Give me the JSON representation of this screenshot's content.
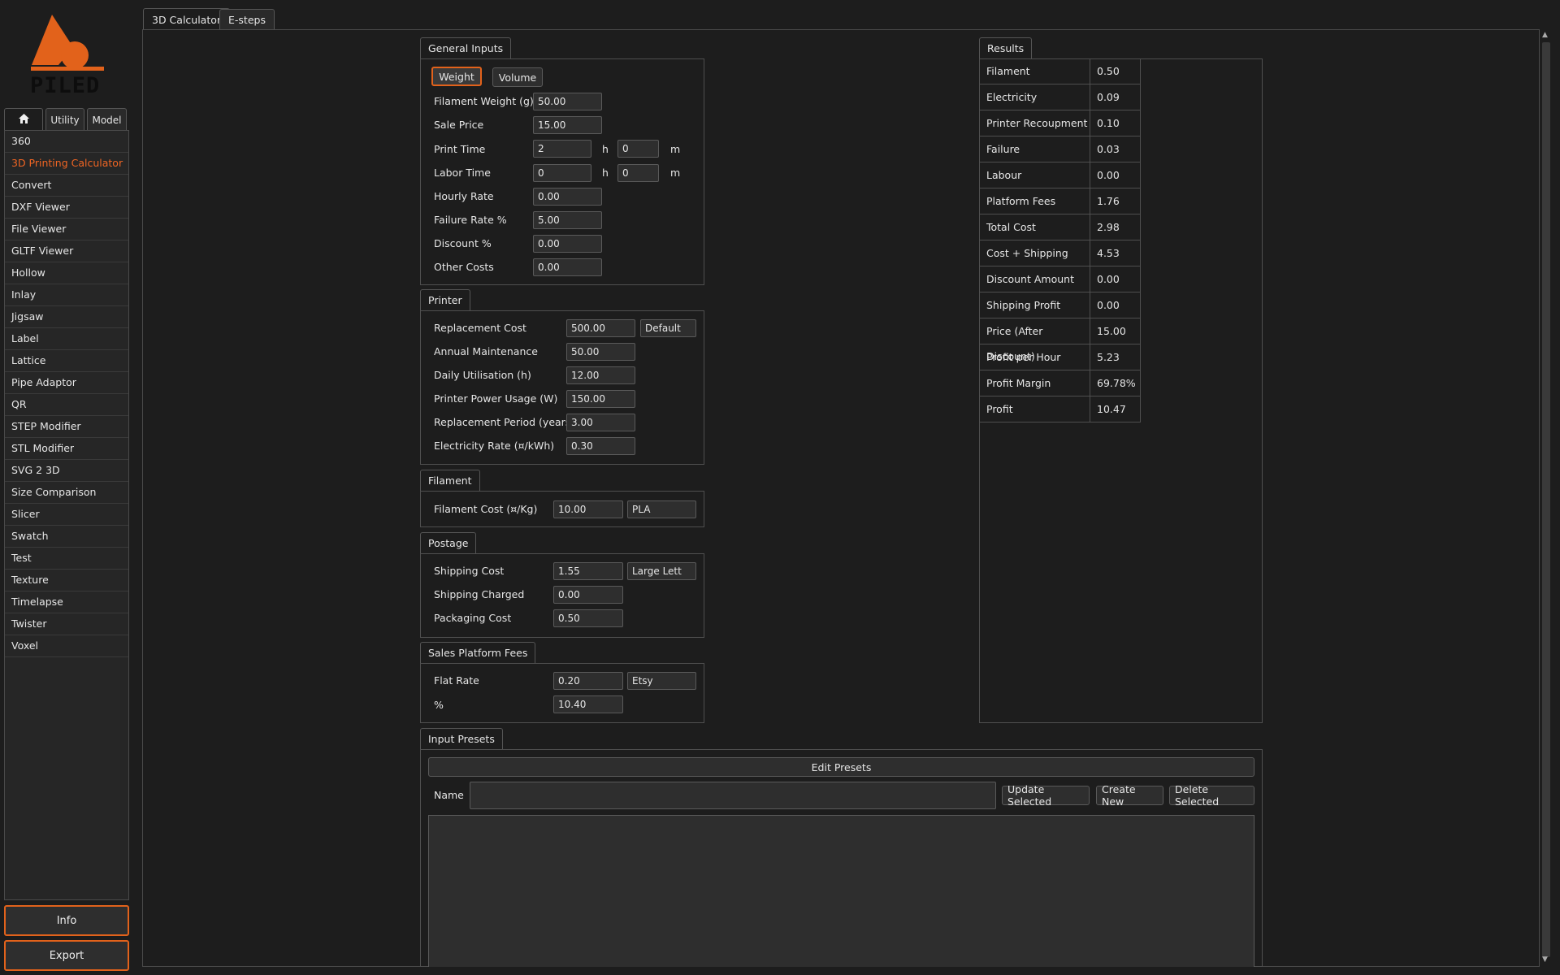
{
  "app": {
    "logo_text": "PILED"
  },
  "sidebar": {
    "tabs": [
      {
        "label": ""
      },
      {
        "label": "Utility"
      },
      {
        "label": "Model"
      }
    ],
    "items": [
      "360",
      "3D Printing Calculator",
      "Convert",
      "DXF Viewer",
      "File Viewer",
      "GLTF Viewer",
      "Hollow",
      "Inlay",
      "Jigsaw",
      "Label",
      "Lattice",
      "Pipe Adaptor",
      "QR",
      "STEP Modifier",
      "STL Modifier",
      "SVG 2 3D",
      "Size Comparison",
      "Slicer",
      "Swatch",
      "Test",
      "Texture",
      "Timelapse",
      "Twister",
      "Voxel"
    ],
    "active_item": "3D Printing Calculator",
    "info_label": "Info",
    "export_label": "Export"
  },
  "main_tabs": [
    "3D Calculator",
    "E-steps"
  ],
  "general": {
    "title": "General Inputs",
    "mode_weight": "Weight",
    "mode_volume": "Volume",
    "filament_weight_label": "Filament Weight (g)",
    "filament_weight": "50.00",
    "sale_price_label": "Sale Price",
    "sale_price": "15.00",
    "print_time_label": "Print Time",
    "print_time_h": "2",
    "print_time_m": "0",
    "labor_time_label": "Labor Time",
    "labor_time_h": "0",
    "labor_time_m": "0",
    "h_unit": "h",
    "m_unit": "m",
    "hourly_rate_label": "Hourly Rate",
    "hourly_rate": "0.00",
    "failure_rate_label": "Failure Rate %",
    "failure_rate": "5.00",
    "discount_label": "Discount %",
    "discount": "0.00",
    "other_costs_label": "Other Costs",
    "other_costs": "0.00"
  },
  "printer": {
    "title": "Printer",
    "replacement_cost_label": "Replacement Cost",
    "replacement_cost": "500.00",
    "preset": "Default",
    "annual_maintenance_label": "Annual Maintenance",
    "annual_maintenance": "50.00",
    "daily_utilisation_label": "Daily Utilisation (h)",
    "daily_utilisation": "12.00",
    "power_usage_label": "Printer Power Usage (W)",
    "power_usage": "150.00",
    "replacement_period_label": "Replacement Period (years)",
    "replacement_period": "3.00",
    "electricity_rate_label": "Electricity Rate (¤/kWh)",
    "electricity_rate": "0.30"
  },
  "filament": {
    "title": "Filament",
    "cost_label": "Filament Cost (¤/Kg)",
    "cost": "10.00",
    "material": "PLA"
  },
  "postage": {
    "title": "Postage",
    "shipping_cost_label": "Shipping Cost",
    "shipping_cost": "1.55",
    "service": "Large Lett",
    "shipping_charged_label": "Shipping Charged",
    "shipping_charged": "0.00",
    "packaging_cost_label": "Packaging Cost",
    "packaging_cost": "0.50"
  },
  "platform": {
    "title": "Sales Platform Fees",
    "flat_rate_label": "Flat Rate",
    "flat_rate": "0.20",
    "platform": "Etsy",
    "percent_label": "%",
    "percent": "10.40"
  },
  "results": {
    "title": "Results",
    "rows": [
      {
        "name": "Filament",
        "value": "0.50"
      },
      {
        "name": "Electricity",
        "value": "0.09"
      },
      {
        "name": "Printer Recoupment",
        "value": "0.10"
      },
      {
        "name": "Failure",
        "value": "0.03"
      },
      {
        "name": "Labour",
        "value": "0.00"
      },
      {
        "name": "Platform Fees",
        "value": "1.76"
      },
      {
        "name": "Total Cost",
        "value": "2.98"
      },
      {
        "name": "Cost + Shipping",
        "value": "4.53"
      },
      {
        "name": "Discount Amount",
        "value": "0.00"
      },
      {
        "name": "Shipping Profit",
        "value": "0.00"
      },
      {
        "name": "Price (After Discount)",
        "value": "15.00"
      },
      {
        "name": "Profit per Hour",
        "value": "5.23"
      },
      {
        "name": "Profit Margin",
        "value": "69.78%"
      },
      {
        "name": "Profit",
        "value": "10.47"
      }
    ]
  },
  "presets": {
    "title": "Input Presets",
    "edit_label": "Edit Presets",
    "name_label": "Name",
    "name_value": "",
    "update_label": "Update Selected",
    "create_label": "Create New",
    "delete_label": "Delete Selected"
  },
  "colors": {
    "accent": "#e2621b",
    "background": "#1d1d1d",
    "panel": "#2e2e2e"
  }
}
